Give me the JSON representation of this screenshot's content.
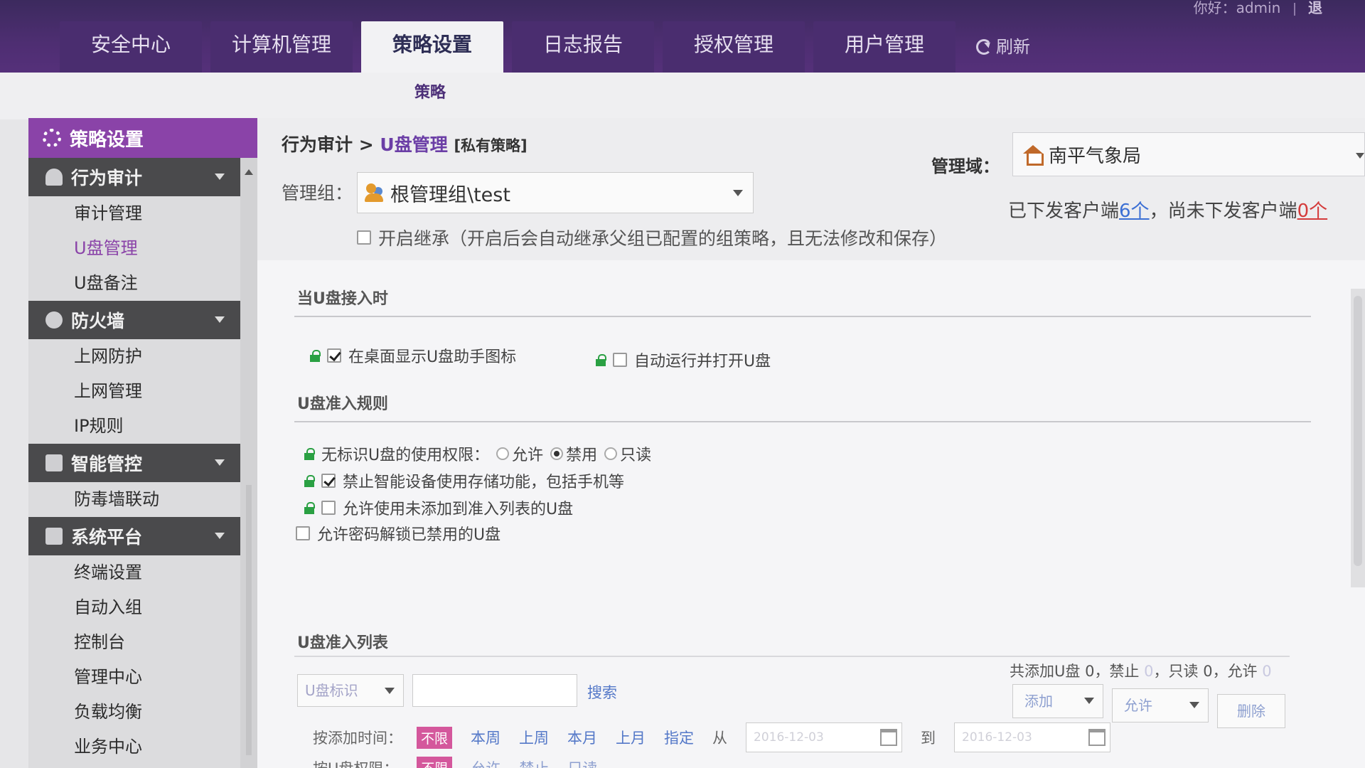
{
  "header": {
    "greeting": "你好：admin",
    "extra": "退",
    "tabs": [
      {
        "label": "安全中心"
      },
      {
        "label": "计算机管理"
      },
      {
        "label": "策略设置"
      },
      {
        "label": "日志报告"
      },
      {
        "label": "授权管理"
      },
      {
        "label": "用户管理"
      }
    ],
    "refresh_label": "刷新",
    "active_tab": "策略设置",
    "subtab": "策略"
  },
  "sidebar": {
    "title": "策略设置",
    "groups": [
      {
        "label": "行为审计",
        "icon": "user-icon",
        "items": [
          "审计管理",
          "U盘管理",
          "U盘备注"
        ]
      },
      {
        "label": "防火墙",
        "icon": "globe-icon",
        "items": [
          "上网防护",
          "上网管理",
          "IP规则"
        ]
      },
      {
        "label": "智能管控",
        "icon": "chart-icon",
        "items": [
          "防毒墙联动"
        ]
      },
      {
        "label": "系统平台",
        "icon": "monitor-icon",
        "items": [
          "终端设置",
          "自动入组",
          "控制台",
          "管理中心",
          "负载均衡",
          "业务中心"
        ]
      }
    ],
    "active_item": "U盘管理"
  },
  "breadcrumb": {
    "parent": "行为审计",
    "sep": ">",
    "current": "U盘管理",
    "tag": "[私有策略]"
  },
  "domain": {
    "label": "管理域：",
    "value": "南平气象局"
  },
  "group": {
    "label": "管理组：",
    "value": "根管理组\\test"
  },
  "clients": {
    "sent_prefix": "已下发客户端",
    "sent_count": "6个",
    "mid": "，尚未下发客户端",
    "unsent_count": "0个"
  },
  "inherit": {
    "label": "开启继承（开启后会自动继承父组已配置的组策略，且无法修改和保存）",
    "checked": false
  },
  "section1": {
    "title": "当U盘接入时",
    "options": [
      {
        "label": "在桌面显示U盘助手图标",
        "checked": true
      },
      {
        "label": "自动运行并打开U盘",
        "checked": false
      }
    ]
  },
  "section2": {
    "title": "U盘准入规则",
    "perm_label": "无标识U盘的使用权限：",
    "perm_options": [
      "允许",
      "禁用",
      "只读"
    ],
    "perm_selected": "禁用",
    "rules": [
      {
        "label": "禁止智能设备使用存储功能，包括手机等",
        "checked": true
      },
      {
        "label": "允许使用未添加到准入列表的U盘",
        "checked": false
      },
      {
        "label": "允许密码解锁已禁用的U盘",
        "checked": false
      }
    ]
  },
  "section3": {
    "title": "U盘准入列表",
    "filter_value": "U盘标识",
    "search_label": "搜索",
    "summary_prefix": "共添加U盘",
    "summary": {
      "total": "0",
      "forbid_label": "，禁止",
      "forbid": "0",
      "readonly_label": "，只读",
      "readonly": "0",
      "allow_label": "，允许",
      "allow": "0"
    },
    "add_label": "添加",
    "allow_select": "允许",
    "delete_label": "删除",
    "time_label": "按添加时间：",
    "time_options": [
      "不限",
      "本周",
      "上周",
      "本月",
      "上月",
      "指定"
    ],
    "from_label": "从",
    "to_label": "到",
    "date_from": "2016-12-03",
    "date_to": "2016-12-03",
    "perm_filter_label": "按U盘权限：",
    "perm_filter_options": [
      "不限",
      "允许",
      "禁止",
      "只读"
    ]
  }
}
